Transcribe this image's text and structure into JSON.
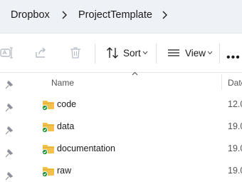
{
  "breadcrumb": {
    "items": [
      {
        "label": "Dropbox"
      },
      {
        "label": "ProjectTemplate"
      }
    ]
  },
  "toolbar": {
    "sort_label": "Sort",
    "view_label": "View",
    "more_label": "•••"
  },
  "columns": {
    "name": "Name",
    "date": "Date"
  },
  "files": [
    {
      "name": "code",
      "date": "12.0"
    },
    {
      "name": "data",
      "date": "19.0"
    },
    {
      "name": "documentation",
      "date": "19.0"
    },
    {
      "name": "raw",
      "date": "19.0"
    }
  ],
  "colors": {
    "folder": "#f2c14b",
    "sync_ok": "#1e8e3e",
    "accent": "#005fb8"
  },
  "icons": [
    "rename-icon",
    "share-icon",
    "delete-icon",
    "sort-icon",
    "view-icon",
    "pin-icon",
    "folder-icon",
    "sync-check-icon"
  ]
}
